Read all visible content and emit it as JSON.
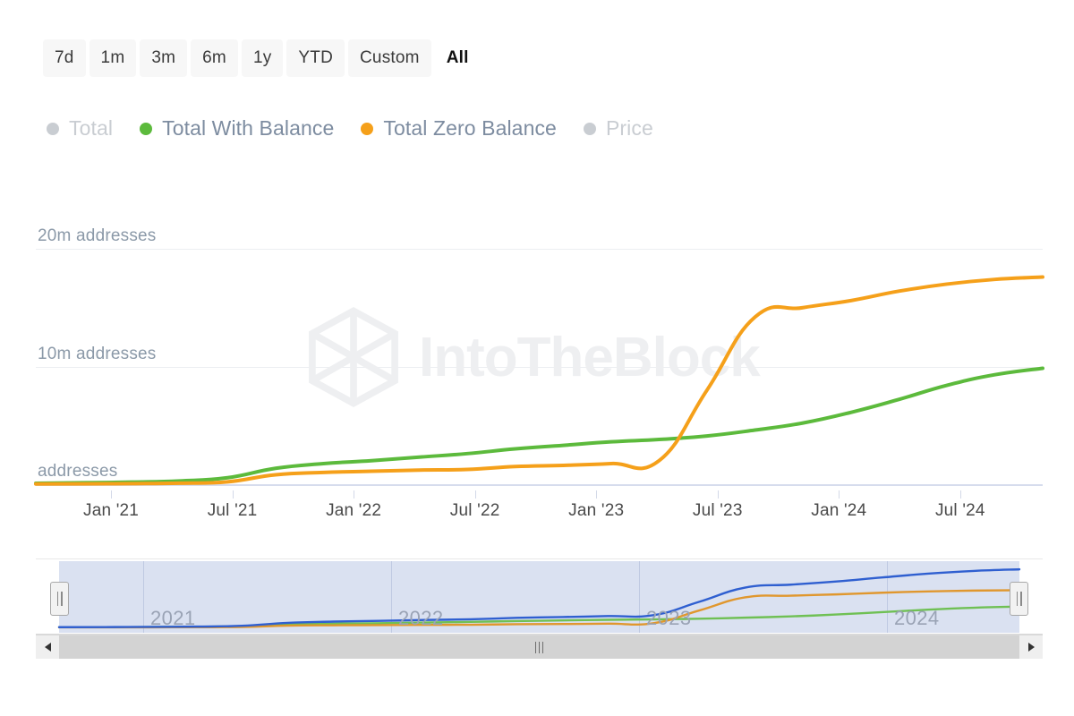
{
  "range_selector": {
    "options": [
      {
        "label": "7d",
        "selected": false
      },
      {
        "label": "1m",
        "selected": false
      },
      {
        "label": "3m",
        "selected": false
      },
      {
        "label": "6m",
        "selected": false
      },
      {
        "label": "1y",
        "selected": false
      },
      {
        "label": "YTD",
        "selected": false
      },
      {
        "label": "Custom",
        "selected": false
      },
      {
        "label": "All",
        "selected": true
      }
    ]
  },
  "legend": {
    "items": [
      {
        "label": "Total",
        "color": "#c9cdd2",
        "active": false
      },
      {
        "label": "Total With Balance",
        "color": "#5cba3c",
        "active": true
      },
      {
        "label": "Total Zero Balance",
        "color": "#f5a01a",
        "active": true
      },
      {
        "label": "Price",
        "color": "#c9cdd2",
        "active": false
      }
    ]
  },
  "watermark": {
    "text": "IntoTheBlock",
    "color": "#eeeff1"
  },
  "navigator": {
    "years": [
      "2021",
      "2022",
      "2023",
      "2024"
    ],
    "series_colors": {
      "total": "#2f5fd0",
      "zero_balance": "#e0972e",
      "with_balance": "#6fc054"
    },
    "handle_left_label": "left-resize-handle",
    "handle_right_label": "right-resize-handle"
  },
  "scrollbar": {
    "left_arrow": "◀",
    "right_arrow": "▶"
  },
  "chart_data": {
    "type": "line",
    "title": "",
    "xlabel": "",
    "ylabel": "addresses",
    "ylim": [
      0,
      22
    ],
    "yticks": [
      0,
      10,
      20
    ],
    "ytick_labels": [
      "addresses",
      "10m addresses",
      "20m addresses"
    ],
    "grid": true,
    "legend_position": "top",
    "xticks": [
      "Jan '21",
      "Jul '21",
      "Jan '22",
      "Jul '22",
      "Jan '23",
      "Jul '23",
      "Jan '24",
      "Jul '24"
    ],
    "x_unit": "millions of addresses",
    "x": [
      "2020-10",
      "2021-01",
      "2021-04",
      "2021-07",
      "2021-10",
      "2021-12",
      "2022-02",
      "2022-04",
      "2022-07",
      "2022-10",
      "2022-12",
      "2023-02",
      "2023-04",
      "2023-05",
      "2023-06",
      "2023-07",
      "2023-08",
      "2023-10",
      "2024-01",
      "2024-04",
      "2024-07",
      "2024-09"
    ],
    "series": [
      {
        "name": "Total With Balance",
        "color": "#5cba3c",
        "visible": true,
        "values": [
          0.08,
          0.12,
          0.18,
          0.28,
          0.55,
          1.35,
          1.75,
          2.0,
          2.3,
          2.6,
          3.0,
          3.3,
          3.6,
          3.8,
          4.1,
          4.6,
          5.2,
          6.1,
          7.2,
          8.4,
          9.3,
          9.85
        ]
      },
      {
        "name": "Total Zero Balance",
        "color": "#f5a01a",
        "visible": true,
        "values": [
          0.02,
          0.03,
          0.05,
          0.09,
          0.2,
          0.8,
          1.0,
          1.1,
          1.2,
          1.25,
          1.5,
          1.6,
          1.75,
          2.0,
          8.0,
          14.2,
          15.0,
          15.6,
          16.4,
          17.0,
          17.4,
          17.6
        ]
      },
      {
        "name": "Total",
        "color": "#c9cdd2",
        "visible": false,
        "values": []
      },
      {
        "name": "Price",
        "color": "#c9cdd2",
        "visible": false,
        "values": []
      }
    ]
  }
}
